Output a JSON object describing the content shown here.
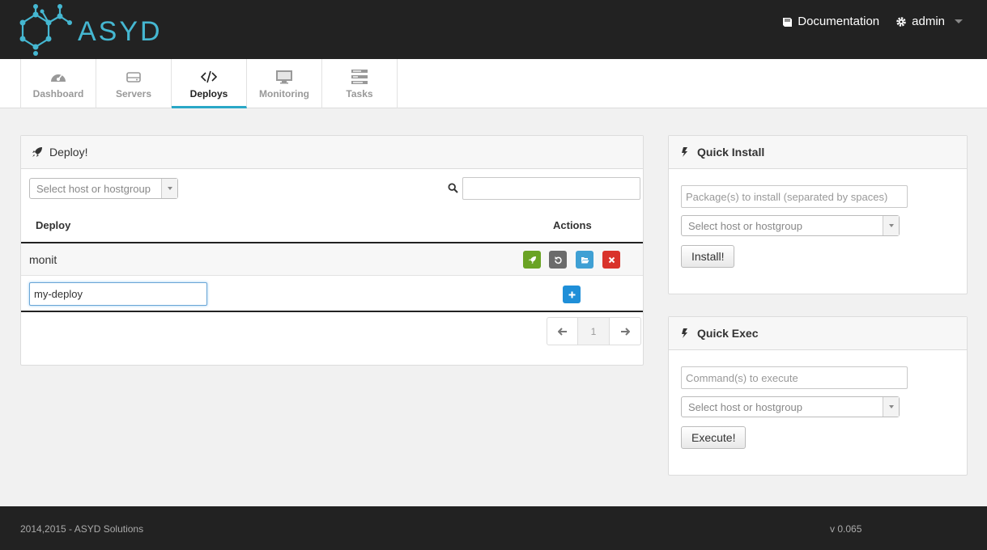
{
  "header": {
    "logo_text": "ASYD",
    "documentation_label": "Documentation",
    "user_label": "admin"
  },
  "tabs": [
    {
      "label": "Dashboard",
      "icon": "dashboard-icon",
      "active": false
    },
    {
      "label": "Servers",
      "icon": "server-icon",
      "active": false
    },
    {
      "label": "Deploys",
      "icon": "code-icon",
      "active": true
    },
    {
      "label": "Monitoring",
      "icon": "monitor-icon",
      "active": false
    },
    {
      "label": "Tasks",
      "icon": "tasks-icon",
      "active": false
    }
  ],
  "deploy_panel": {
    "title": "Deploy!",
    "host_select": "Select host or hostgroup",
    "search_value": "",
    "col_deploy": "Deploy",
    "col_actions": "Actions",
    "rows": [
      {
        "name": "monit"
      }
    ],
    "new_deploy_value": "my-deploy",
    "pager": {
      "prev": "←",
      "page": "1",
      "next": "→"
    }
  },
  "quick_install": {
    "title": "Quick Install",
    "packages_placeholder": "Package(s) to install (separated by spaces)",
    "host_select": "Select host or hostgroup",
    "button_label": "Install!"
  },
  "quick_exec": {
    "title": "Quick Exec",
    "command_placeholder": "Command(s) to execute",
    "host_select": "Select host or hostgroup",
    "button_label": "Execute!"
  },
  "footer": {
    "copyright": "2014,2015 - ASYD Solutions",
    "version": "v 0.065"
  },
  "colors": {
    "accent": "#2aa7c7",
    "deploy_green": "#6aa324",
    "redeploy_gray": "#6b6b6b",
    "browse_blue": "#3fa0d4",
    "delete_red": "#d9332b",
    "add_blue": "#1f8fd8"
  }
}
